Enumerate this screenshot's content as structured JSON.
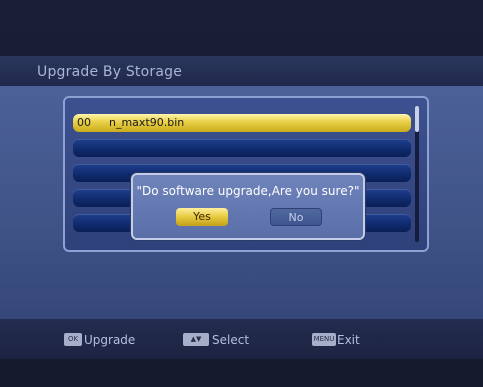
{
  "title": "Upgrade By Storage",
  "files": [
    {
      "num": "00",
      "name": "n_maxt90.bin",
      "selected": true
    },
    {
      "num": "",
      "name": "",
      "selected": false
    },
    {
      "num": "",
      "name": "",
      "selected": false
    },
    {
      "num": "",
      "name": "",
      "selected": false
    },
    {
      "num": "",
      "name": "",
      "selected": false
    },
    {
      "num": "",
      "name": "",
      "selected": false
    }
  ],
  "dialog": {
    "message": "\"Do software upgrade,Are you sure?\"",
    "yes": "Yes",
    "no": "No"
  },
  "footer": {
    "ok_key": "OK",
    "ok_label": "Upgrade",
    "select_key": "▲▼",
    "select_label": "Select",
    "menu_key": "MENU",
    "exit_label": "Exit"
  }
}
